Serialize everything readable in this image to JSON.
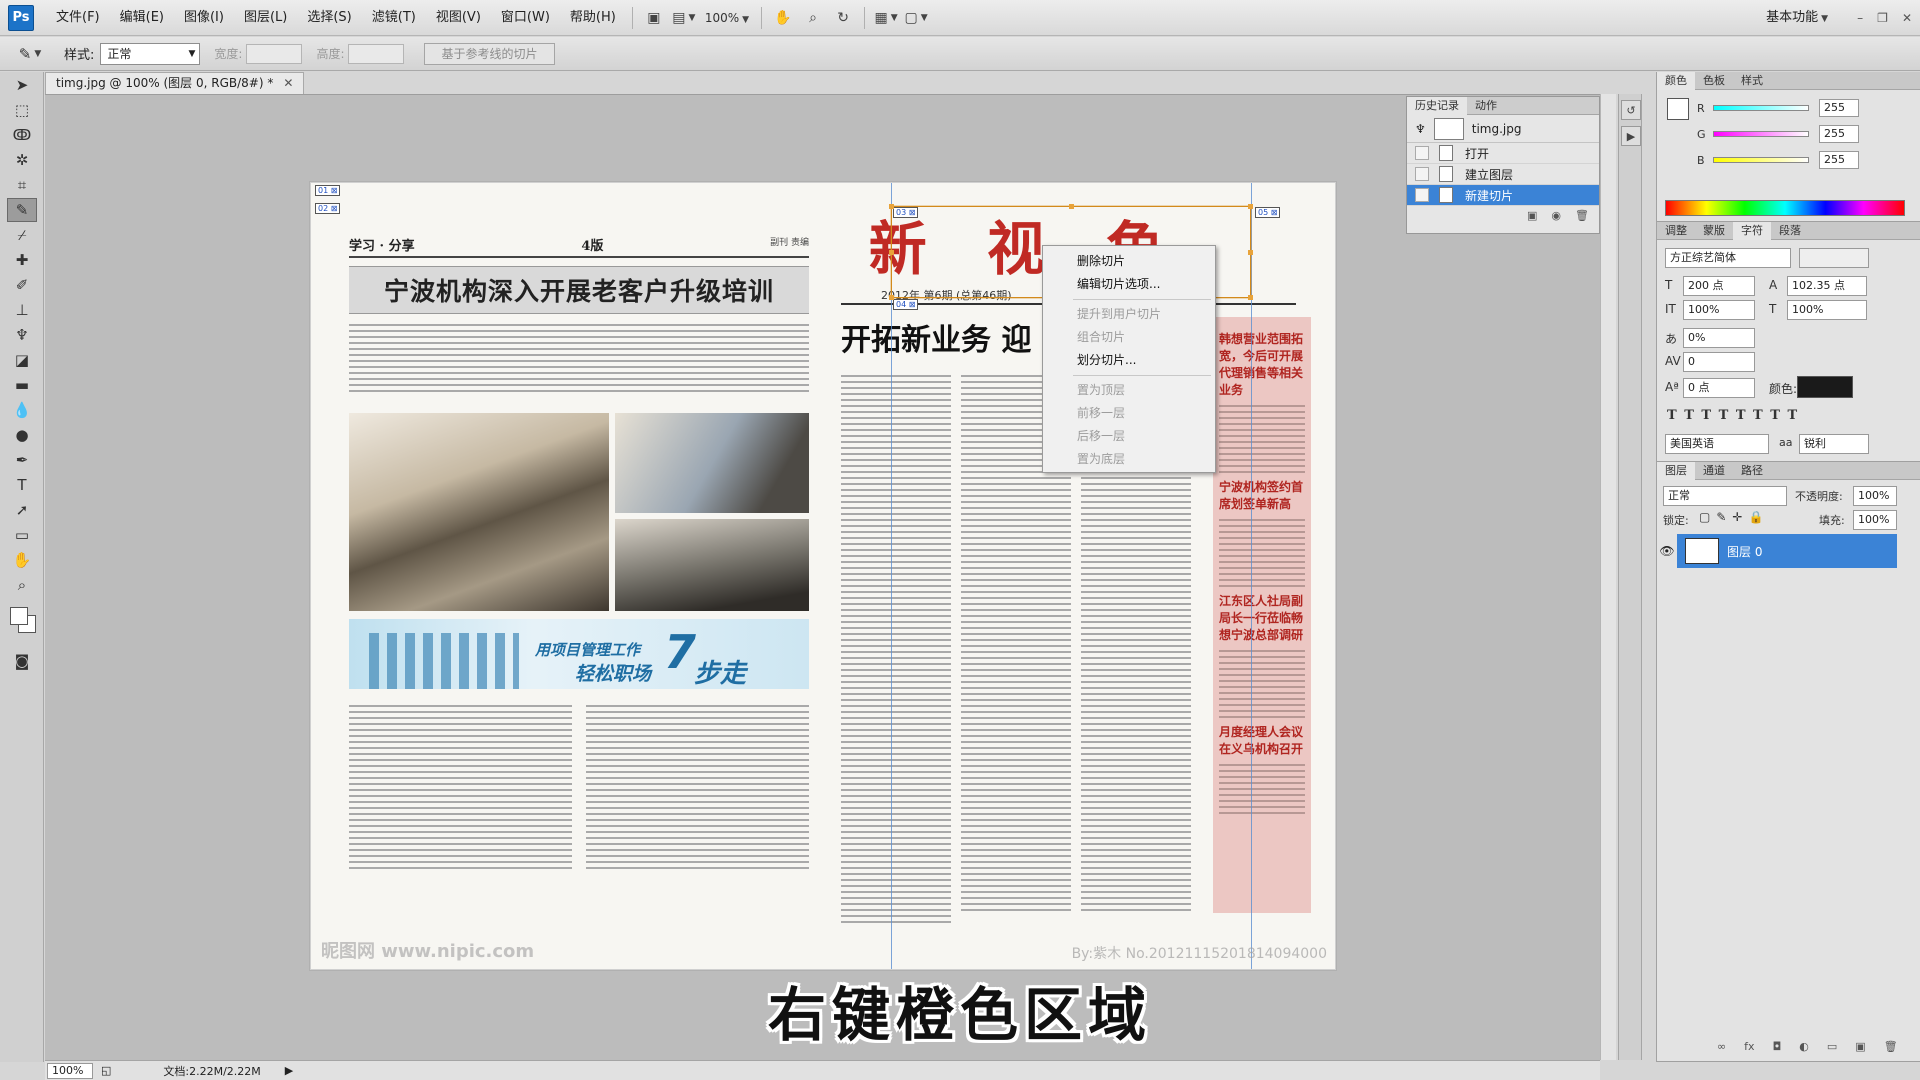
{
  "app": {
    "logo": "Ps",
    "menu": [
      "文件(F)",
      "编辑(E)",
      "图像(I)",
      "图层(L)",
      "选择(S)",
      "滤镜(T)",
      "视图(V)",
      "窗口(W)",
      "帮助(H)"
    ],
    "zoom": "100%",
    "workspace": "基本功能"
  },
  "options": {
    "style_label": "样式:",
    "style_value": "正常",
    "width_label": "宽度:",
    "height_label": "高度:",
    "slice_button": "基于参考线的切片"
  },
  "document": {
    "tab_title": "timg.jpg @ 100% (图层 0, RGB/8#) *"
  },
  "image": {
    "left_header": "学习 · 分享",
    "left_page_num": "4版",
    "left_header_right": "副刊 责编",
    "left_headline": "宁波机构深入开展老客户升级培训",
    "banner_line1": "用项目管理工作",
    "banner_line2": "轻松职场",
    "banner_big": "7",
    "banner_tail": "步走",
    "watermark_left": "昵图网 www.nipic.com",
    "watermark_right": "By:紫木 No.20121115201814094000",
    "masthead": "新 视 角",
    "issue_line": "2012年 第6期 (总第46期)",
    "right_headline": "开拓新业务 迎",
    "aside_heads": [
      "韩想营业范围拓宽，今后可开展代理销售等相关业务",
      "宁波机构签约首席划签单新高",
      "江东区人社局副局长一行莅临畅想宁波总部调研",
      "月度经理人会议在义乌机构召开"
    ]
  },
  "context_menu": {
    "items": [
      {
        "label": "删除切片",
        "enabled": true
      },
      {
        "label": "编辑切片选项...",
        "enabled": true
      },
      {
        "label": "提升到用户切片",
        "enabled": false
      },
      {
        "label": "组合切片",
        "enabled": false
      },
      {
        "label": "划分切片...",
        "enabled": true
      },
      {
        "label": "置为顶层",
        "enabled": false
      },
      {
        "label": "前移一层",
        "enabled": false
      },
      {
        "label": "后移一层",
        "enabled": false
      },
      {
        "label": "置为底层",
        "enabled": false
      }
    ]
  },
  "history": {
    "tabs": [
      "历史记录",
      "动作"
    ],
    "snapshot": "timg.jpg",
    "steps": [
      "打开",
      "建立图层",
      "新建切片"
    ],
    "active_step": "新建切片"
  },
  "color_panel": {
    "tabs": [
      "颜色",
      "色板",
      "样式"
    ],
    "channels": [
      {
        "name": "R",
        "value": "255"
      },
      {
        "name": "G",
        "value": "255"
      },
      {
        "name": "B",
        "value": "255"
      }
    ]
  },
  "character_panel": {
    "tabs": [
      "调整",
      "蒙版",
      "字符",
      "段落"
    ],
    "font_family": "方正综艺简体",
    "font_size": "200 点",
    "leading": "102.35 点",
    "vertical_scale": "100%",
    "horizontal_scale": "100%",
    "tracking_percent": "0%",
    "kerning": "0",
    "baseline": "0 点",
    "color_label": "颜色:",
    "language": "美国英语",
    "antialias_label": "aa",
    "antialias": "锐利"
  },
  "layers_panel": {
    "tabs": [
      "图层",
      "通道",
      "路径"
    ],
    "blend_mode": "正常",
    "opacity_label": "不透明度:",
    "opacity": "100%",
    "lock_label": "锁定:",
    "fill_label": "填充:",
    "fill": "100%",
    "layer_name": "图层 0"
  },
  "status": {
    "zoom": "100%",
    "doc_info": "文档:2.22M/2.22M"
  },
  "subtitle": "右键橙色区域",
  "colors": {
    "accent_blue": "#3b83d6",
    "masthead_red": "#c02a24",
    "slice_orange": "#d38a1c"
  }
}
